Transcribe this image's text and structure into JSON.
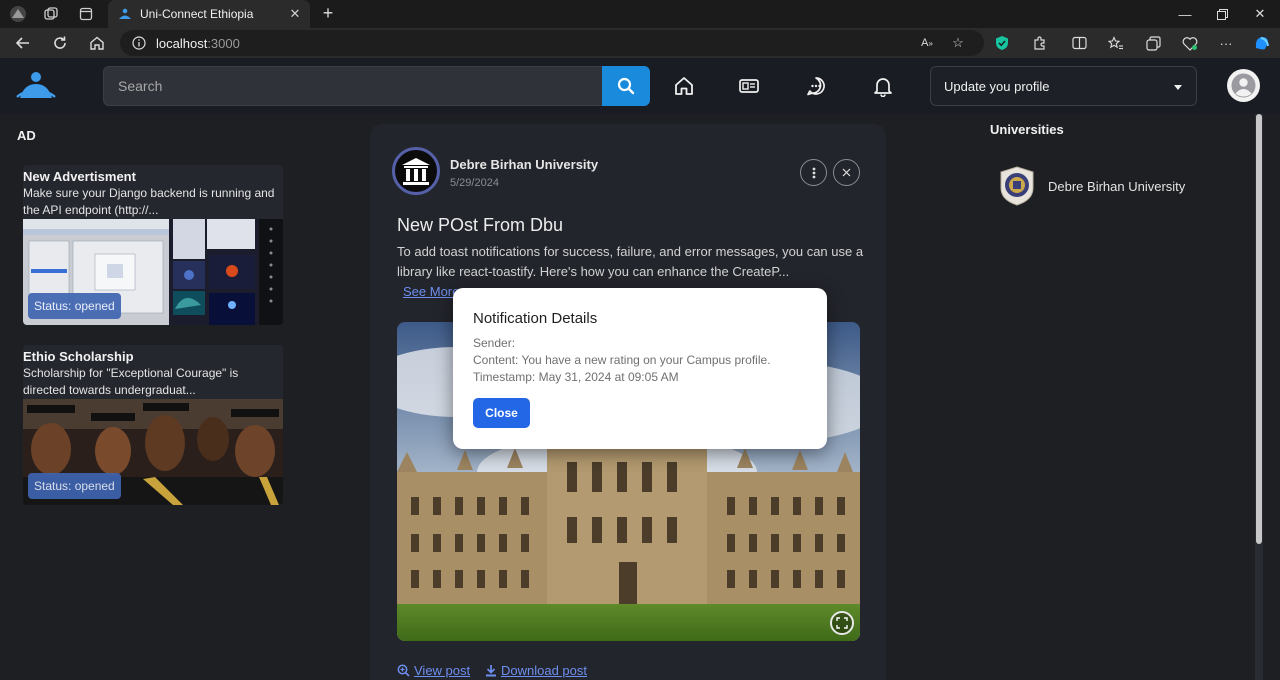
{
  "browser": {
    "tab_title": "Uni-Connect Ethiopia",
    "url_host": "localhost",
    "url_port": ":3000"
  },
  "header": {
    "search_placeholder": "Search",
    "profile_select_value": "Update you profile",
    "icons": [
      "home-icon",
      "news-icon",
      "chat-icon",
      "bell-icon"
    ]
  },
  "ads": {
    "heading": "AD",
    "items": [
      {
        "title": "New Advertisment",
        "description": "Make sure your Django backend is running and the API endpoint (http://...",
        "status": "Status: opened"
      },
      {
        "title": "Ethio Scholarship",
        "description": "Scholarship for \"Exceptional Courage\" is directed towards undergraduat...",
        "status": "Status: opened"
      }
    ]
  },
  "post": {
    "author": "Debre Birhan University",
    "date": "5/29/2024",
    "title": "New POst From Dbu",
    "body": "To add toast notifications for success, failure, and error messages, you can use a library like react-toastify. Here's how you can enhance the CreateP...",
    "see_more": "See More",
    "view_post": "View post",
    "download_post": "Download post"
  },
  "universities": {
    "heading": "Universities",
    "items": [
      {
        "name": "Debre Birhan University"
      }
    ]
  },
  "modal": {
    "title": "Notification Details",
    "sender": "Sender:",
    "content": "Content: You have a new rating on your Campus profile.",
    "timestamp": "Timestamp: May 31, 2024 at 09:05 AM",
    "close_label": "Close"
  },
  "colors": {
    "accent_blue": "#1a8bdc",
    "link_blue": "#6e8ef0",
    "button_blue": "#2467e6",
    "badge_blue": "#3f64b0",
    "page_bg": "#1e1f22",
    "card_bg": "#23252c"
  }
}
